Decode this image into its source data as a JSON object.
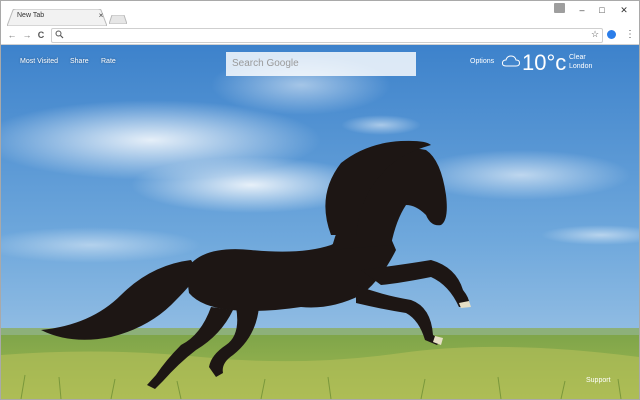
{
  "browser": {
    "tab_title": "New Tab",
    "close_glyph": "×",
    "window_controls": {
      "minimize": "–",
      "maximize": "□",
      "close": "✕"
    },
    "nav": {
      "back": "←",
      "forward": "→",
      "reload": "C"
    },
    "address_value": "",
    "star_glyph": "☆",
    "menu_glyph": "⋮"
  },
  "page": {
    "links": {
      "most_visited": "Most Visited",
      "share": "Share",
      "rate": "Rate"
    },
    "search": {
      "placeholder": "Search Google"
    },
    "options_label": "Options",
    "weather": {
      "icon": "cloud-icon",
      "temperature": "10°c",
      "condition": "Clear",
      "city": "London"
    },
    "support_label": "Support"
  },
  "colors": {
    "sky": "#4f8fd0",
    "grass": "#8ab14c",
    "horse": "#1d1614",
    "ext_icon": "#2b7de9"
  }
}
